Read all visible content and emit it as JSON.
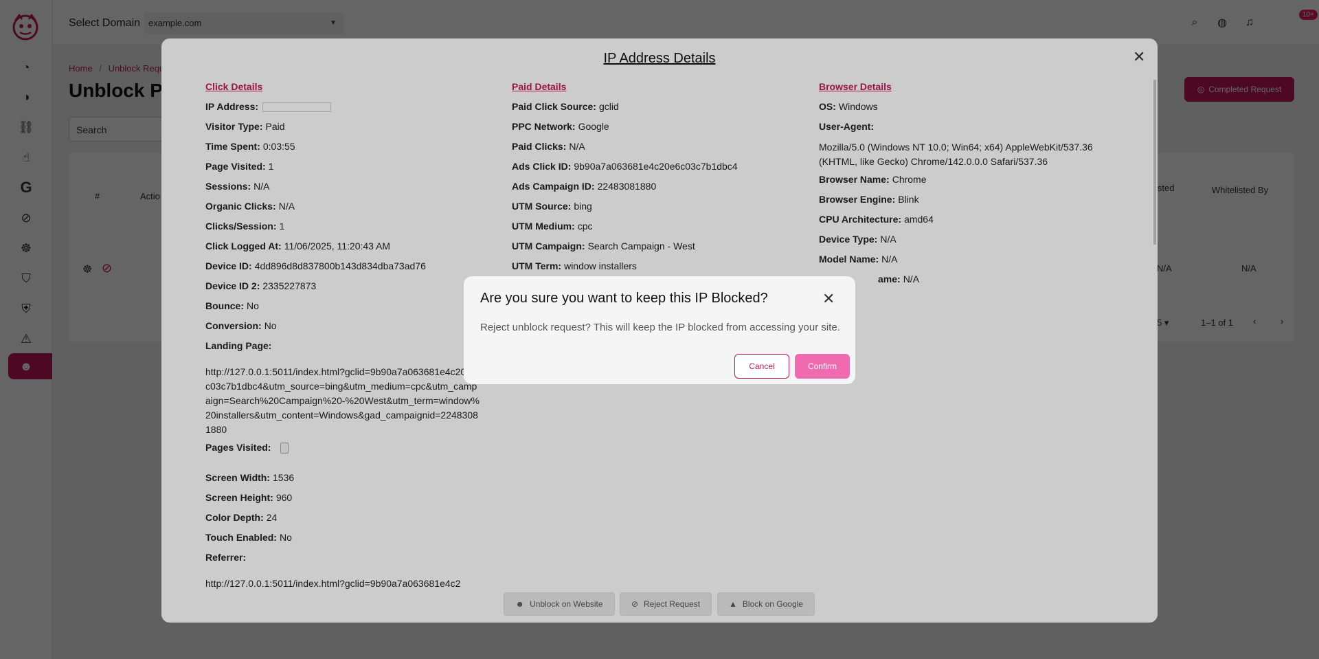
{
  "topbar": {
    "domain_label": "Select Domain",
    "domain_value": "example.com",
    "notification_badge": "10+"
  },
  "background": {
    "breadcrumb_home": "Home",
    "breadcrumb_sep": "/",
    "breadcrumb_current": "Unblock Requ",
    "page_title": "Unblock P",
    "search_placeholder": "Search",
    "completed_request": "Completed Request",
    "table_headers": [
      "#",
      "Actio",
      "isted",
      "Whitelisted By"
    ],
    "row_values": [
      "N/A",
      "N/A"
    ],
    "pagination_rows": "5",
    "pagination_range": "1–1 of 1"
  },
  "ip_modal": {
    "title": "IP Address Details",
    "click_details": {
      "heading": "Click Details",
      "rows": [
        {
          "label": "IP Address:",
          "value": ""
        },
        {
          "label": "Visitor Type:",
          "value": "Paid"
        },
        {
          "label": "Time Spent:",
          "value": "0:03:55"
        },
        {
          "label": "Page Visited:",
          "value": "1"
        },
        {
          "label": "Sessions:",
          "value": "N/A"
        },
        {
          "label": "Organic Clicks:",
          "value": "N/A"
        },
        {
          "label": "Clicks/Session:",
          "value": "1"
        },
        {
          "label": "Click Logged At:",
          "value": "11/06/2025, 11:20:43 AM"
        },
        {
          "label": "Device ID:",
          "value": "4dd896d8d837800b143d834dba73ad76"
        },
        {
          "label": "Device ID 2:",
          "value": "2335227873"
        },
        {
          "label": "Bounce:",
          "value": "No"
        },
        {
          "label": "Conversion:",
          "value": "No"
        }
      ],
      "landing_label": "Landing Page:",
      "landing_url": "http://127.0.0.1:5011/index.html?gclid=9b90a7a063681e4c20e6c03c7b1dbc4&utm_source=bing&utm_medium=cpc&utm_campaign=Search%20Campaign%20-%20West&utm_term=window%20installers&utm_content=Windows&gad_campaignid=22483081880",
      "pages_visited_label": "Pages Visited:",
      "rows2": [
        {
          "label": "Screen Width:",
          "value": "1536"
        },
        {
          "label": "Screen Height:",
          "value": "960"
        },
        {
          "label": "Color Depth:",
          "value": "24"
        },
        {
          "label": "Touch Enabled:",
          "value": "No"
        }
      ],
      "referrer_label": "Referrer:",
      "referrer_url": "http://127.0.0.1:5011/index.html?gclid=9b90a7a063681e4c2"
    },
    "paid_details": {
      "heading": "Paid Details",
      "rows": [
        {
          "label": "Paid Click Source:",
          "value": "gclid"
        },
        {
          "label": "PPC Network:",
          "value": "Google"
        },
        {
          "label": "Paid Clicks:",
          "value": "N/A"
        },
        {
          "label": "Ads Click ID:",
          "value": "9b90a7a063681e4c20e6c03c7b1dbc4"
        },
        {
          "label": "Ads Campaign ID:",
          "value": "22483081880"
        },
        {
          "label": "UTM Source:",
          "value": "bing"
        },
        {
          "label": "UTM Medium:",
          "value": "cpc"
        },
        {
          "label": "UTM Campaign:",
          "value": "Search Campaign - West"
        },
        {
          "label": "UTM Term:",
          "value": "window installers"
        }
      ]
    },
    "browser_details": {
      "heading": "Browser Details",
      "os_label": "OS:",
      "os_value": "Windows",
      "ua_label": "User-Agent:",
      "ua_value": "Mozilla/5.0 (Windows NT 10.0; Win64; x64) AppleWebKit/537.36 (KHTML, like Gecko) Chrome/142.0.0.0 Safari/537.36",
      "rows": [
        {
          "label": "Browser Name:",
          "value": "Chrome"
        },
        {
          "label": "Browser Engine:",
          "value": "Blink"
        },
        {
          "label": "CPU Architecture:",
          "value": "amd64"
        },
        {
          "label": "Device Type:",
          "value": "N/A"
        },
        {
          "label": "Model Name:",
          "value": "N/A"
        },
        {
          "label": "ame:",
          "value": "N/A"
        }
      ]
    },
    "actions": {
      "unblock": "Unblock on Website",
      "reject": "Reject Request",
      "block_google": "Block on Google"
    }
  },
  "confirm_dialog": {
    "title": "Are you sure you want to keep this IP Blocked?",
    "message": "Reject unblock request? This will keep the IP blocked from accessing your site.",
    "cancel": "Cancel",
    "confirm": "Confirm"
  },
  "colors": {
    "brand": "#c2185b",
    "confirm_button": "#f06ab0"
  }
}
